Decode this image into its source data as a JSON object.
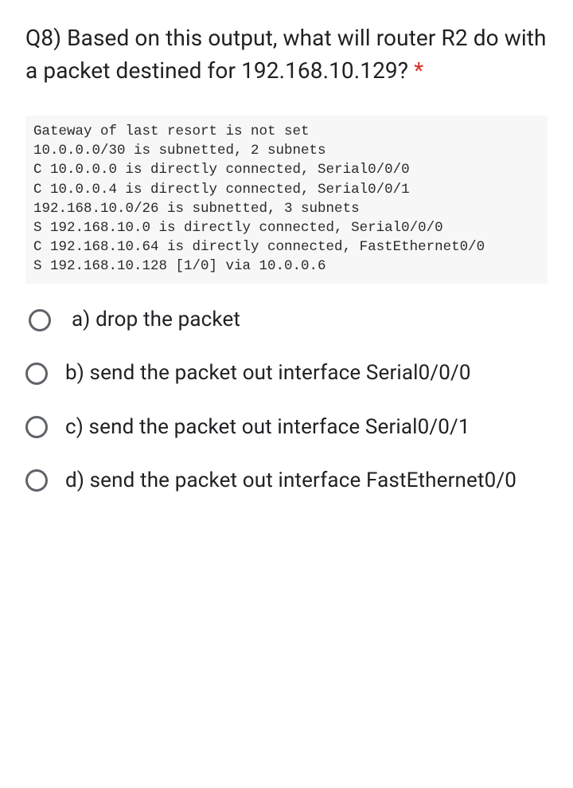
{
  "question": {
    "title": "Q8) Based on this output, what will router R2 do with a packet destined for 192.168.10.129?",
    "required_mark": "*"
  },
  "code_block": "Gateway of last resort is not set\n10.0.0.0/30 is subnetted, 2 subnets\nC 10.0.0.0 is directly connected, Serial0/0/0\nC 10.0.0.4 is directly connected, Serial0/0/1\n192.168.10.0/26 is subnetted, 3 subnets\nS 192.168.10.0 is directly connected, Serial0/0/0\nC 192.168.10.64 is directly connected, FastEthernet0/0\nS 192.168.10.128 [1/0] via 10.0.0.6",
  "options": {
    "a": "a) drop the packet",
    "b": "b) send the packet out interface Serial0/0/0",
    "c": "c) send the packet out interface Serial0/0/1",
    "d": "d) send the packet out interface FastEthernet0/0"
  }
}
